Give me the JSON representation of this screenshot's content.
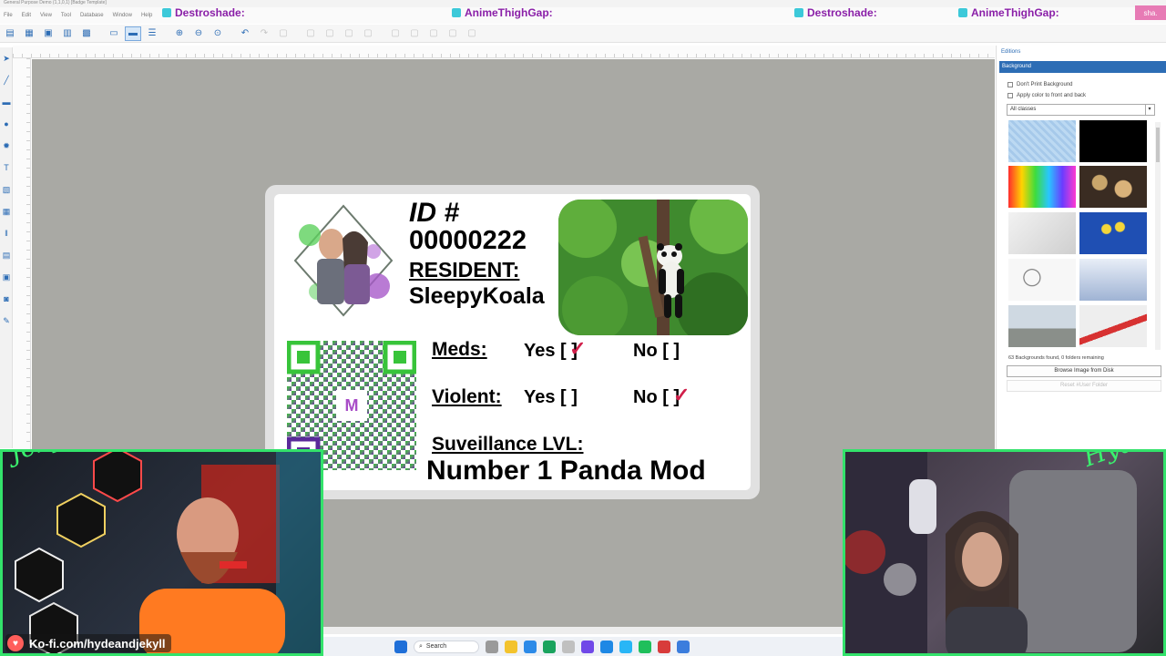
{
  "window": {
    "title": "General Purpose Demo (1,1,0,1) [Badge Template]",
    "menu": [
      "File",
      "Edit",
      "View",
      "Tool",
      "Database",
      "Window",
      "Help"
    ]
  },
  "stream_overlay": {
    "items": [
      {
        "label": "Destroshade:",
        "color": "#8a1fa8"
      },
      {
        "label": "AnimeThighGap:",
        "color": "#8a1fa8"
      },
      {
        "label": "Destroshade:",
        "color": "#8a1fa8"
      },
      {
        "label": "AnimeThighGap:",
        "color": "#8a1fa8"
      }
    ],
    "corner_badge": "sha."
  },
  "toolbar": {
    "icons": [
      "new-file-icon",
      "open-icon",
      "save-icon",
      "save-as-icon",
      "print-icon",
      "layout-icon",
      "card-icon",
      "list-icon",
      "zoom-in-icon",
      "zoom-out-icon",
      "zoom-fit-icon",
      "undo-icon",
      "redo-icon",
      "align-icon",
      "align-left-icon",
      "align-right-icon",
      "align-top-icon",
      "align-bottom-icon",
      "group-icon",
      "ungroup-icon",
      "send-back-icon",
      "bring-front-icon",
      "lock-icon"
    ]
  },
  "left_tools": [
    "pointer-icon",
    "line-icon",
    "rectangle-icon",
    "ellipse-icon",
    "polygon-icon",
    "text-icon",
    "image-icon",
    "barcode-icon",
    "calendar-icon",
    "grid-icon",
    "photo-icon",
    "camera-icon",
    "signature-icon",
    "qr-icon"
  ],
  "id_card": {
    "id_label": "ID #",
    "id_number": "00000222",
    "resident_label": "RESIDENT:",
    "resident_name": "SleepyKoala",
    "meds_label": "Meds:",
    "violent_label": "Violent:",
    "yes_label": "Yes [  ]",
    "no_label": "No [  ]",
    "check_mark": "✓",
    "meds_value": "yes",
    "violent_value": "no",
    "surveillance_label": "Suveillance LVL:",
    "surveillance_value": "Number 1 Panda Mod",
    "accent": "#d11f4a"
  },
  "right_panel": {
    "section_title": "Editions",
    "tab": "Background",
    "options": [
      "Don't Print Background",
      "Apply color to front and back"
    ],
    "category_select": "All classes",
    "thumbnails": [
      "light-blue-pattern",
      "black",
      "rainbow-gradient",
      "clocks",
      "hand-phone",
      "flowers-blue",
      "love-stamp",
      "notebook",
      "truck",
      "pen-red"
    ],
    "count_text": "63 Backgrounds found, 0 folders remaining",
    "browse_button": "Browse Image from Disk",
    "reset_button": "Reset #User Folder"
  },
  "webcams": {
    "left_name": "Jekyll",
    "right_name": "Hyde",
    "kofi_text": "Ko-fi.com/hydeandjekyll",
    "border_color": "#33e26b"
  },
  "taskbar": {
    "search_placeholder": "Search"
  }
}
